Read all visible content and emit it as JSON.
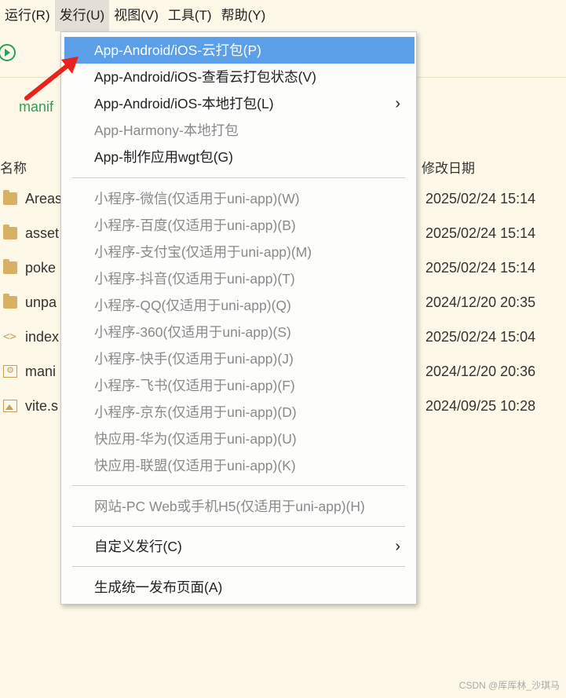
{
  "menubar": [
    {
      "label": "运行(R)",
      "active": false
    },
    {
      "label": "发行(U)",
      "active": true
    },
    {
      "label": "视图(V)",
      "active": false
    },
    {
      "label": "工具(T)",
      "active": false
    },
    {
      "label": "帮助(Y)",
      "active": false
    }
  ],
  "editor": {
    "tab_text": "manif"
  },
  "file_list": {
    "header_name": "名称",
    "header_date": "修改日期",
    "rows": [
      {
        "icon": "folder-icon",
        "name": "Areas",
        "date": "2025/02/24 15:14"
      },
      {
        "icon": "folder-icon",
        "name": "asset",
        "date": "2025/02/24 15:14"
      },
      {
        "icon": "folder-icon",
        "name": "poke",
        "date": "2025/02/24 15:14"
      },
      {
        "icon": "folder-icon",
        "name": "unpa",
        "date": "2024/12/20 20:35"
      },
      {
        "icon": "code-file-icon",
        "name": "index",
        "date": "2025/02/24 15:04"
      },
      {
        "icon": "gear-file-icon",
        "name": "mani",
        "date": "2024/12/20 20:36"
      },
      {
        "icon": "image-file-icon",
        "name": "vite.s",
        "date": "2024/09/25 10:28"
      }
    ]
  },
  "dropdown": {
    "items": [
      {
        "label": "App-Android/iOS-云打包(P)",
        "state": "highlight",
        "submenu": false
      },
      {
        "label": "App-Android/iOS-查看云打包状态(V)",
        "state": "enabled",
        "submenu": false
      },
      {
        "label": "App-Android/iOS-本地打包(L)",
        "state": "enabled",
        "submenu": true
      },
      {
        "label": "App-Harmony-本地打包",
        "state": "disabled",
        "submenu": false
      },
      {
        "label": "App-制作应用wgt包(G)",
        "state": "enabled",
        "submenu": false
      },
      {
        "label": "小程序-微信(仅适用于uni-app)(W)",
        "state": "disabled",
        "submenu": false
      },
      {
        "label": "小程序-百度(仅适用于uni-app)(B)",
        "state": "disabled",
        "submenu": false
      },
      {
        "label": "小程序-支付宝(仅适用于uni-app)(M)",
        "state": "disabled",
        "submenu": false
      },
      {
        "label": "小程序-抖音(仅适用于uni-app)(T)",
        "state": "disabled",
        "submenu": false
      },
      {
        "label": "小程序-QQ(仅适用于uni-app)(Q)",
        "state": "disabled",
        "submenu": false
      },
      {
        "label": "小程序-360(仅适用于uni-app)(S)",
        "state": "disabled",
        "submenu": false
      },
      {
        "label": "小程序-快手(仅适用于uni-app)(J)",
        "state": "disabled",
        "submenu": false
      },
      {
        "label": "小程序-飞书(仅适用于uni-app)(F)",
        "state": "disabled",
        "submenu": false
      },
      {
        "label": "小程序-京东(仅适用于uni-app)(D)",
        "state": "disabled",
        "submenu": false
      },
      {
        "label": "快应用-华为(仅适用于uni-app)(U)",
        "state": "disabled",
        "submenu": false
      },
      {
        "label": "快应用-联盟(仅适用于uni-app)(K)",
        "state": "disabled",
        "submenu": false
      },
      {
        "label": "网站-PC Web或手机H5(仅适用于uni-app)(H)",
        "state": "disabled",
        "submenu": false
      },
      {
        "label": "自定义发行(C)",
        "state": "enabled",
        "submenu": true
      },
      {
        "label": "生成统一发布页面(A)",
        "state": "enabled",
        "submenu": false
      }
    ]
  },
  "colors": {
    "highlight": "#5b9fe8",
    "background": "#fdf8e8",
    "run_green": "#2f9e58",
    "arrow_red": "#e8231c"
  },
  "watermark": "CSDN @厍厍林_沙琪马"
}
